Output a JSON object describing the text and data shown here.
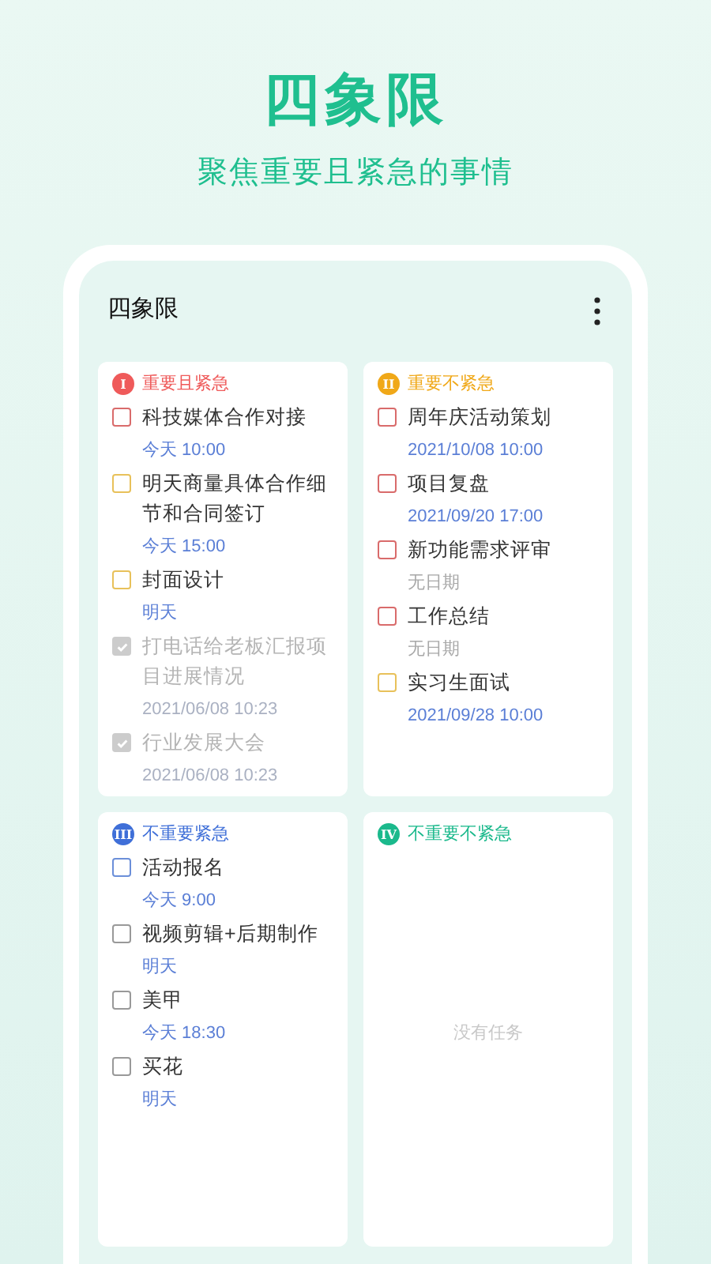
{
  "header": {
    "title": "四象限",
    "subtitle": "聚焦重要且紧急的事情"
  },
  "screen": {
    "title": "四象限"
  },
  "quadrants": [
    {
      "numeral": "I",
      "label": "重要且紧急",
      "color": "#ef5a5a",
      "tasks": [
        {
          "title": "科技媒体合作对接",
          "date": "今天 10:00",
          "kind": "dated",
          "color": "#d96b6b",
          "done": false
        },
        {
          "title": "明天商量具体合作细节和合同签订",
          "date": "今天 15:00",
          "kind": "dated",
          "color": "#e8c15a",
          "done": false
        },
        {
          "title": "封面设计",
          "date": "明天",
          "kind": "dated",
          "color": "#e8c15a",
          "done": false
        },
        {
          "title": "打电话给老板汇报项目进展情况",
          "date": "2021/06/08 10:23",
          "color": "#cccccc",
          "done": true
        },
        {
          "title": "行业发展大会",
          "date": "2021/06/08 10:23",
          "color": "#cccccc",
          "done": true
        }
      ]
    },
    {
      "numeral": "II",
      "label": "重要不紧急",
      "color": "#f0a818",
      "tasks": [
        {
          "title": "周年庆活动策划",
          "date": "2021/10/08 10:00",
          "kind": "dated",
          "color": "#d96b6b",
          "done": false
        },
        {
          "title": "项目复盘",
          "date": "2021/09/20 17:00",
          "kind": "dated",
          "color": "#d96b6b",
          "done": false
        },
        {
          "title": "新功能需求评审",
          "date": "无日期",
          "kind": "undated",
          "color": "#d96b6b",
          "done": false
        },
        {
          "title": "工作总结",
          "date": "无日期",
          "kind": "undated",
          "color": "#d96b6b",
          "done": false
        },
        {
          "title": "实习生面试",
          "date": "2021/09/28 10:00",
          "kind": "dated",
          "color": "#e8c15a",
          "done": false
        }
      ]
    },
    {
      "numeral": "III",
      "label": "不重要紧急",
      "color": "#3f6fd8",
      "tasks": [
        {
          "title": "活动报名",
          "date": "今天 9:00",
          "kind": "dated",
          "color": "#6b8fd9",
          "done": false
        },
        {
          "title": "视频剪辑+后期制作",
          "date": "明天",
          "kind": "dated",
          "color": "#999999",
          "done": false
        },
        {
          "title": "美甲",
          "date": "今天 18:30",
          "kind": "dated",
          "color": "#999999",
          "done": false
        },
        {
          "title": "买花",
          "date": "明天",
          "kind": "dated",
          "color": "#999999",
          "done": false
        }
      ]
    },
    {
      "numeral": "IV",
      "label": "不重要不紧急",
      "color": "#1bb98c",
      "empty_text": "没有任务"
    }
  ]
}
